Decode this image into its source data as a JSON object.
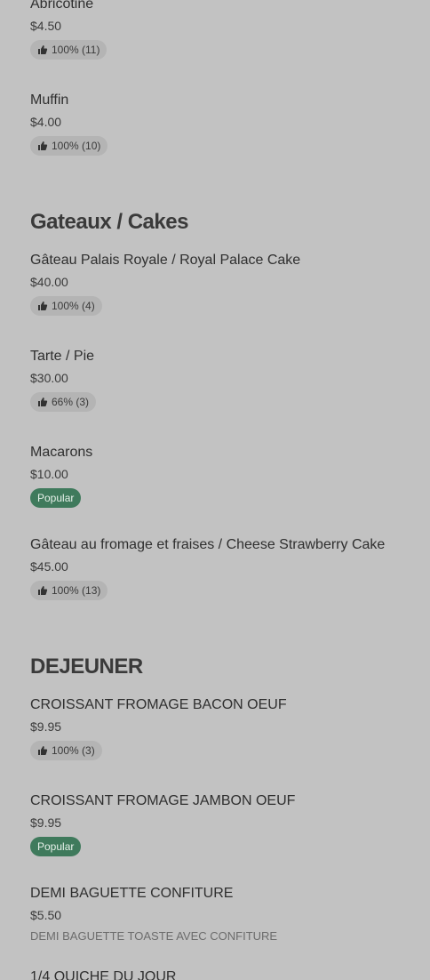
{
  "rating_icon": "thumbs-up-icon",
  "colors": {
    "background": "#c2c2c2",
    "badge_bg": "#b4b4b4",
    "popular_bg": "#3f7a5c"
  },
  "items_top": [
    {
      "name": "Abricotine",
      "price": "$4.50",
      "badge": "100% (11)"
    },
    {
      "name": "Muffin",
      "price": "$4.00",
      "badge": "100% (10)"
    }
  ],
  "sections": [
    {
      "title": "Gateaux / Cakes",
      "items": [
        {
          "name": "Gâteau Palais Royale / Royal Palace Cake",
          "price": "$40.00",
          "badge": "100% (4)"
        },
        {
          "name": "Tarte / Pie",
          "price": "$30.00",
          "badge": "66% (3)"
        },
        {
          "name": "Macarons",
          "price": "$10.00",
          "badge": "Popular"
        },
        {
          "name": "Gâteau au fromage et fraises / Cheese Strawberry Cake",
          "price": "$45.00",
          "badge": "100% (13)"
        }
      ]
    },
    {
      "title": "DEJEUNER",
      "items": [
        {
          "name": "CROISSANT FROMAGE BACON OEUF",
          "price": "$9.95",
          "badge": "100% (3)"
        },
        {
          "name": "CROISSANT FROMAGE JAMBON OEUF",
          "price": "$9.95",
          "badge": "Popular"
        },
        {
          "name": "DEMI BAGUETTE CONFITURE",
          "price": "$5.50",
          "description": "DEMI BAGUETTE TOASTE AVEC CONFITURE"
        },
        {
          "name": "1/4 QUICHE DU JOUR"
        }
      ]
    }
  ]
}
